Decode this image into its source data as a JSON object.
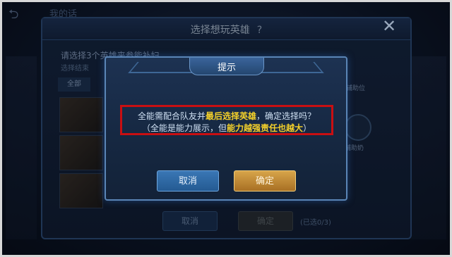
{
  "background": {
    "topic": "我的话",
    "select_title": "选择想玩英雄",
    "help_mark": "?",
    "close_mark": "✕",
    "hint": "请选择3个英雄来参能补妇",
    "hint_sub": "选择结束",
    "tab_all": "全部",
    "side_tag": "辅助位",
    "role_label": "辅助奶",
    "cancel_label": "取消",
    "confirm_label": "确定",
    "selected_count": "(已选0/3)"
  },
  "dialog": {
    "title": "提示",
    "line1_prefix": "全能需配合队友并",
    "line1_highlight": "最后选择英雄",
    "line1_suffix": "，确定选择吗？",
    "line2_prefix": "（全能是能力展示，但",
    "line2_highlight": "能力越强责任也越大",
    "line2_suffix": "）",
    "cancel_label": "取消",
    "confirm_label": "确定"
  },
  "colors": {
    "highlight": "#f4d12a",
    "annotation_border": "#c90f12",
    "confirm_gold": "#d7a44a",
    "cancel_blue": "#3a77b5"
  }
}
